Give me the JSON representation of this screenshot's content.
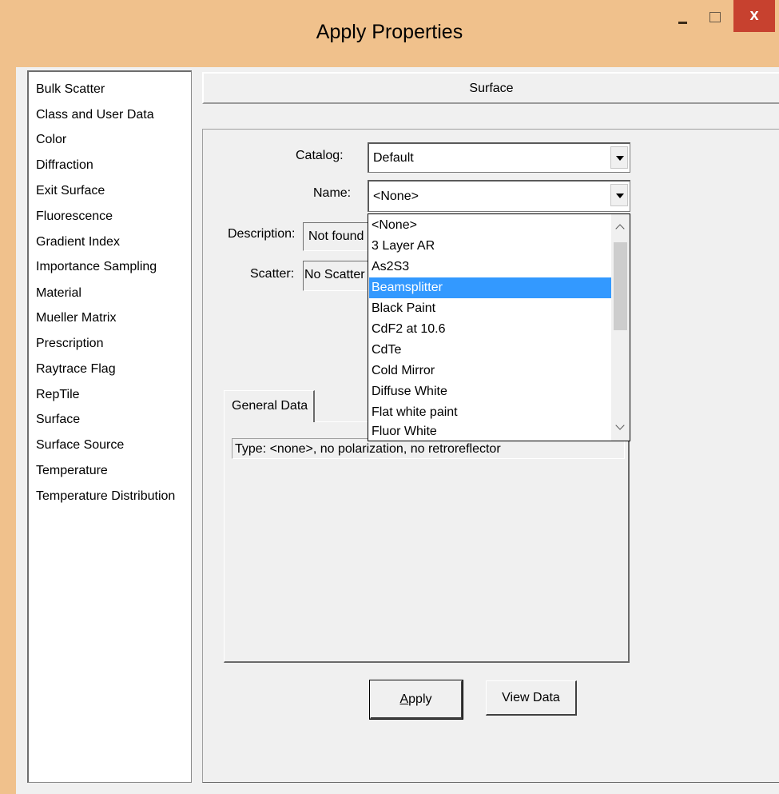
{
  "window": {
    "title": "Apply Properties",
    "close_glyph": "x"
  },
  "categories": {
    "items": [
      "Bulk Scatter",
      "Class and User Data",
      "Color",
      "Diffraction",
      "Exit Surface",
      "Fluorescence",
      "Gradient Index",
      "Importance Sampling",
      "Material",
      "Mueller Matrix",
      "Prescription",
      "Raytrace Flag",
      "RepTile",
      "Surface",
      "Surface Source",
      "Temperature",
      "Temperature Distribution"
    ],
    "selected": "Surface"
  },
  "section": {
    "header": "Surface"
  },
  "form": {
    "catalog_label": "Catalog:",
    "catalog_value": "Default",
    "name_label": "Name:",
    "name_value": "<None>",
    "description_label": "Description:",
    "description_value": "Not found",
    "scatter_label": "Scatter:",
    "scatter_value": "No Scatter"
  },
  "tabs": {
    "general_label": "General Data",
    "type_text": "Type: <none>, no polarization, no retroreflector"
  },
  "buttons": {
    "apply_mnemonic": "A",
    "apply_rest": "pply",
    "view_data": "View Data"
  },
  "dropdown": {
    "items": [
      "<None>",
      "3 Layer AR",
      "As2S3",
      "Beamsplitter",
      "Black Paint",
      "CdF2 at 10.6",
      "CdTe",
      "Cold Mirror",
      "Diffuse White",
      "Flat white paint",
      "Fluor White"
    ],
    "highlighted": "Beamsplitter"
  },
  "icons": {
    "minimize": "minimize-icon",
    "maximize": "maximize-icon",
    "close": "close-icon",
    "combo_arrow": "chevron-down-icon",
    "scroll_up": "chevron-up-icon",
    "scroll_down": "chevron-down-icon"
  },
  "colors": {
    "title_bar": "#f0c18c",
    "close_button": "#c7412f",
    "selection": "#3399ff",
    "client": "#f0f0f0"
  }
}
